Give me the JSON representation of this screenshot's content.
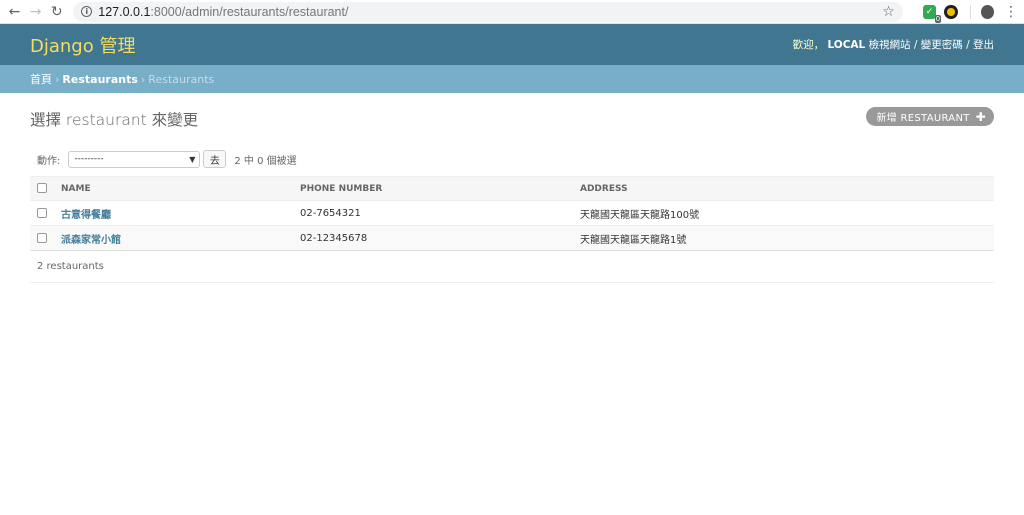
{
  "browser": {
    "url_host": "127.0.0.1",
    "url_path": ":8000/admin/restaurants/restaurant/",
    "extension_count": "0"
  },
  "header": {
    "brand": "Django 管理",
    "welcome": "歡迎，",
    "username": "LOCAL",
    "view_site": "檢視網站",
    "change_password": "變更密碼",
    "logout": "登出",
    "sep": " / "
  },
  "breadcrumbs": {
    "home": "首頁",
    "app": "Restaurants",
    "model": "Restaurants",
    "sep": "›"
  },
  "page": {
    "title": "選擇 restaurant 來變更",
    "add_label": "新增 RESTAURANT"
  },
  "actions": {
    "label": "動作:",
    "selected": "---------",
    "go_label": "去",
    "counter": "2 中 0 個被選"
  },
  "table": {
    "columns": [
      "NAME",
      "PHONE NUMBER",
      "ADDRESS"
    ],
    "rows": [
      {
        "name": "古意得餐廳",
        "phone": "02-7654321",
        "address": "天龍國天龍區天龍路100號"
      },
      {
        "name": "派森家常小館",
        "phone": "02-12345678",
        "address": "天龍國天龍區天龍路1號"
      }
    ]
  },
  "paginator": {
    "text": "2 restaurants"
  }
}
